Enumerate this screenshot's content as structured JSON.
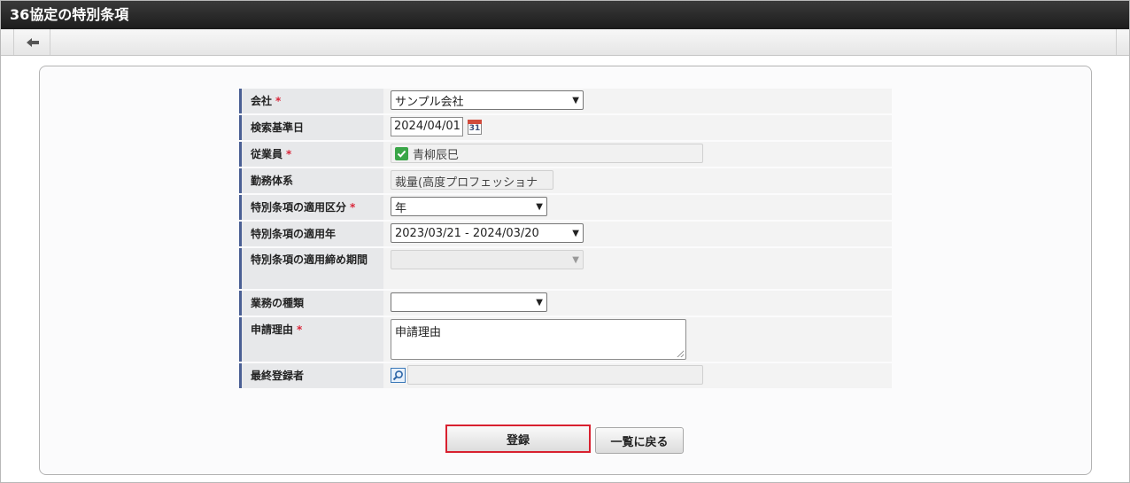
{
  "window": {
    "title": "36協定の特別条項"
  },
  "toolbar": {
    "back_glyph": "⇦"
  },
  "form": {
    "company": {
      "label": "会社",
      "required_mark": "*",
      "value": "サンプル会社"
    },
    "search_date": {
      "label": "検索基準日",
      "value": "2024/04/01",
      "calendar_day": "31"
    },
    "employee": {
      "label": "従業員",
      "required_mark": "*",
      "value": "青柳辰巳"
    },
    "work_system": {
      "label": "勤務体系",
      "value": "裁量(高度プロフェッショナ"
    },
    "apply_division": {
      "label": "特別条項の適用区分",
      "required_mark": "*",
      "value": "年"
    },
    "apply_year": {
      "label": "特別条項の適用年",
      "value": "2023/03/21 - 2024/03/20"
    },
    "apply_closing_period": {
      "label": "特別条項の適用締め期間",
      "value": ""
    },
    "business_type": {
      "label": "業務の種類",
      "value": ""
    },
    "reason": {
      "label": "申請理由",
      "required_mark": "*",
      "value": "申請理由"
    },
    "last_registrant": {
      "label": "最終登録者",
      "value": ""
    }
  },
  "actions": {
    "register_label": "登録",
    "back_to_list_label": "一覧に戻る"
  },
  "colors": {
    "title_bar": "#1c1c1c",
    "label_accent": "#4a5f94",
    "required": "#d9263a",
    "highlight_border": "#d8202f"
  }
}
